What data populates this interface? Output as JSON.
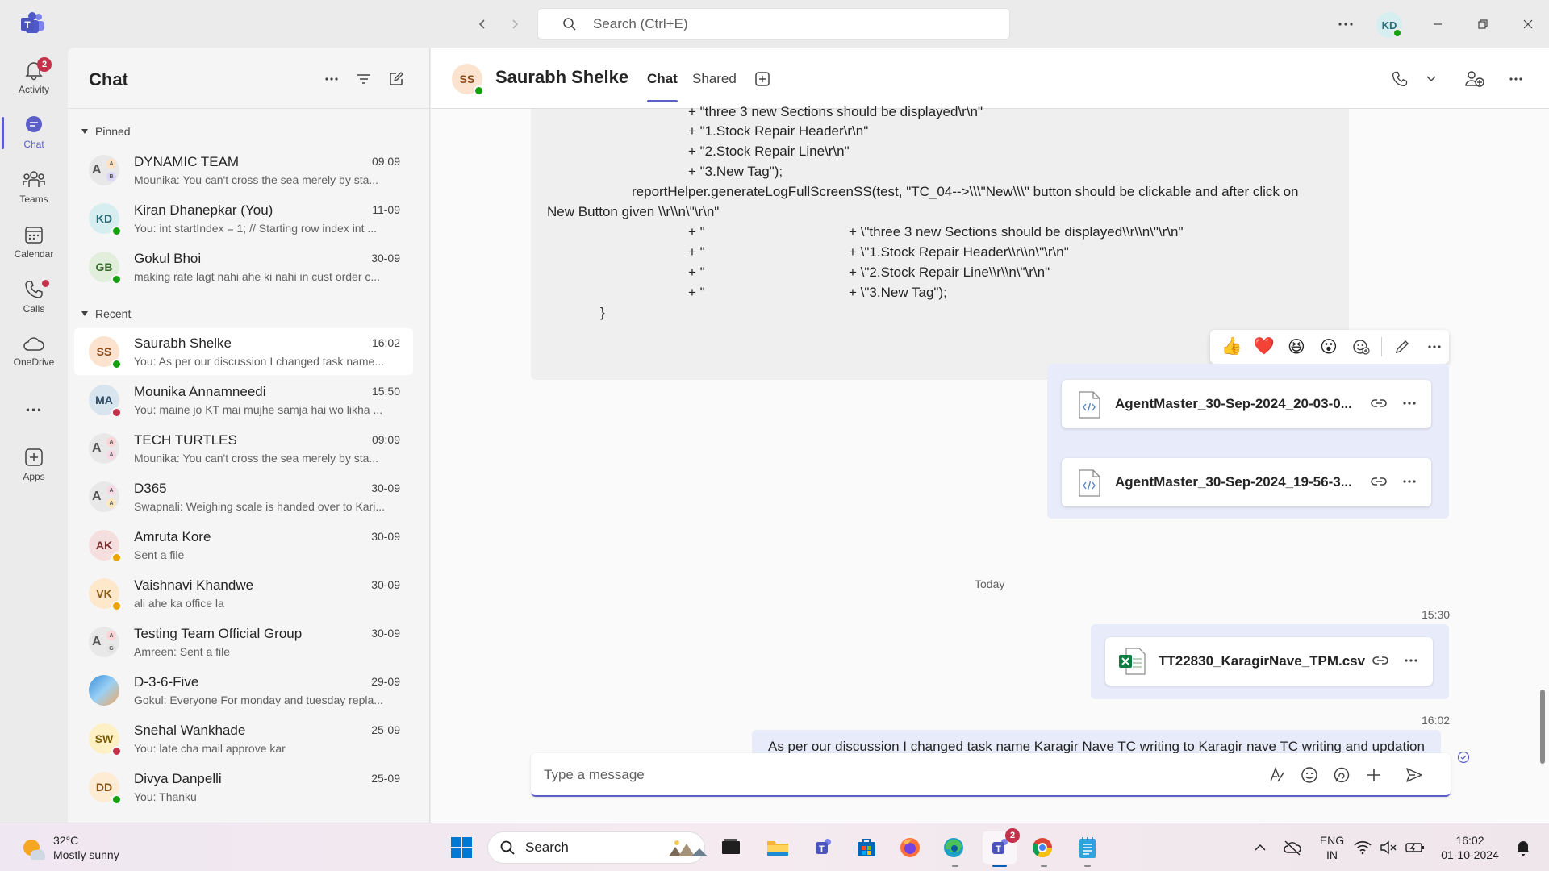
{
  "titlebar": {
    "search_placeholder": "Search (Ctrl+E)",
    "me_initials": "KD"
  },
  "rail": {
    "items": [
      {
        "label": "Activity",
        "badge": "2"
      },
      {
        "label": "Chat"
      },
      {
        "label": "Teams"
      },
      {
        "label": "Calendar"
      },
      {
        "label": "Calls"
      },
      {
        "label": "OneDrive"
      },
      {
        "label": "..."
      },
      {
        "label": "Apps"
      }
    ]
  },
  "chat_list": {
    "title": "Chat",
    "pinned_label": "Pinned",
    "recent_label": "Recent",
    "pinned": [
      {
        "name": "DYNAMIC TEAM",
        "time": "09:09",
        "preview": "Mounika: You can't cross the sea merely by sta...",
        "initials": "A",
        "mini": [
          "A",
          "B"
        ]
      },
      {
        "name": "Kiran Dhanepkar (You)",
        "time": "11-09",
        "preview": "You: int startIndex = 1; // Starting row index int ...",
        "initials": "KD"
      },
      {
        "name": "Gokul Bhoi",
        "time": "30-09",
        "preview": "making rate lagt nahi ahe ki nahi in cust order c...",
        "initials": "GB"
      }
    ],
    "recent": [
      {
        "name": "Saurabh Shelke",
        "time": "16:02",
        "preview": "You: As per our discussion I changed task name...",
        "initials": "SS"
      },
      {
        "name": "Mounika Annamneedi",
        "time": "15:50",
        "preview": "You: maine jo KT mai mujhe samja hai wo likha ...",
        "initials": "MA"
      },
      {
        "name": "TECH TURTLES",
        "time": "09:09",
        "preview": "Mounika: You can't cross the sea merely by sta...",
        "initials": "A",
        "mini": [
          "A",
          "A"
        ]
      },
      {
        "name": "D365",
        "time": "30-09",
        "preview": "Swapnali: Weighing scale is handed over to Kari...",
        "initials": "A",
        "mini": [
          "A",
          "A"
        ]
      },
      {
        "name": "Amruta Kore",
        "time": "30-09",
        "preview": "Sent a file",
        "initials": "AK"
      },
      {
        "name": "Vaishnavi Khandwe",
        "time": "30-09",
        "preview": "ali ahe ka office la",
        "initials": "VK"
      },
      {
        "name": "Testing Team Official Group",
        "time": "30-09",
        "preview": "Amreen: Sent a file",
        "initials": "A",
        "mini": [
          "A",
          "G"
        ]
      },
      {
        "name": "D-3-6-Five",
        "time": "29-09",
        "preview": "Gokul: Everyone For monday and tuesday repla..."
      },
      {
        "name": "Snehal Wankhade",
        "time": "25-09",
        "preview": "You: late cha mail approve kar",
        "initials": "SW"
      },
      {
        "name": "Divya Danpelli",
        "time": "25-09",
        "preview": "You: Thanku",
        "initials": "DD"
      }
    ]
  },
  "conversation": {
    "name": "Saurabh Shelke",
    "initials": "SS",
    "tabs": [
      "Chat",
      "Shared"
    ],
    "code_lines": [
      "+ \"three 3 new Sections should be displayed\\r\\n\"",
      "+ \"1.Stock Repair Header\\r\\n\"",
      "+ \"2.Stock Repair Line\\r\\n\"",
      "+ \"3.New Tag\");",
      "reportHelper.generateLogFullScreenSS(test, \"TC_04-->\\\\\\\"New\\\\\\\" button should be clickable and after click on",
      "New Button given \\\\r\\\\n\\\"\\r\\n\"",
      "+ \"",
      "+ \\\"three 3 new Sections should be displayed\\\\r\\\\n\\\"\\r\\n\"",
      "+ \"",
      "+ \\\"1.Stock Repair Header\\\\r\\\\n\\\"\\r\\n\"",
      "+ \"",
      "+ \\\"2.Stock Repair Line\\\\r\\\\n\\\"\\r\\n\"",
      "+ \"",
      "+ \\\"3.New Tag\");",
      "}"
    ],
    "reactions": [
      "👍",
      "❤️",
      "😆",
      "😮"
    ],
    "files_top": [
      {
        "name": "AgentMaster_30-Sep-2024_20-03-0..."
      },
      {
        "name": "AgentMaster_30-Sep-2024_19-56-3..."
      }
    ],
    "day_separator": "Today",
    "csv_time": "15:30",
    "csv_file": "TT22830_KaragirNave_TPM.csv",
    "last_time": "16:02",
    "last_message": "As per our discussion I changed task name Karagir Nave TC writing to Karagir nave TC writing and updation",
    "composer_placeholder": "Type a message"
  },
  "taskbar": {
    "temperature": "32°C",
    "weather": "Mostly sunny",
    "search_label": "Search",
    "teams_badge": "2",
    "lang_top": "ENG",
    "lang_bottom": "IN",
    "time": "16:02",
    "date": "01-10-2024"
  }
}
